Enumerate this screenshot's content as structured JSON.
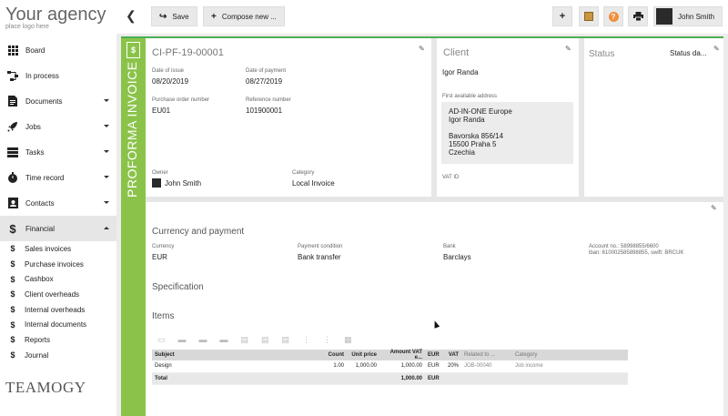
{
  "logo": {
    "title": "Your agency",
    "subtitle": "place logo here"
  },
  "brand": "TEAMOGY",
  "nav": [
    {
      "label": "Board",
      "icon": "grid-icon",
      "caret": false
    },
    {
      "label": "In process",
      "icon": "flow-icon",
      "caret": false
    },
    {
      "label": "Documents",
      "icon": "document-icon",
      "caret": true
    },
    {
      "label": "Jobs",
      "icon": "rocket-icon",
      "caret": true
    },
    {
      "label": "Tasks",
      "icon": "tasks-icon",
      "caret": true
    },
    {
      "label": "Time record",
      "icon": "stopwatch-icon",
      "caret": true
    },
    {
      "label": "Contacts",
      "icon": "contacts-icon",
      "caret": true
    },
    {
      "label": "Financial",
      "icon": "dollar-icon",
      "caret": true
    }
  ],
  "financial_sub": [
    "Sales invoices",
    "Purchase invoices",
    "Cashbox",
    "Client overheads",
    "Internal overheads",
    "Internal documents",
    "Reports",
    "Journal"
  ],
  "toolbar": {
    "save": "Save",
    "compose": "Compose new ...",
    "user": "John Smith"
  },
  "doc": {
    "number": "CI-PF-19-00001",
    "type_label": "PROFORMA INVOICE",
    "date_of_issue_label": "Date of issue",
    "date_of_issue": "08/20/2019",
    "date_of_payment_label": "Date of payment",
    "date_of_payment": "08/27/2019",
    "po_label": "Purchase order number",
    "po": "EU01",
    "ref_label": "Reference number",
    "ref": "101900001",
    "owner_label": "Owner",
    "owner": "John Smith",
    "category_label": "Category",
    "category": "Local Invoice"
  },
  "client": {
    "title": "Client",
    "name": "Igor Randa",
    "address_label": "First available address",
    "address": [
      "AD-IN-ONE Europe",
      "Igor Randa",
      "",
      "Bavorska 856/14",
      "15500 Praha 5",
      "Czechia"
    ],
    "vat_label": "VAT ID"
  },
  "status": {
    "title": "Status",
    "value": "Status da..."
  },
  "payment": {
    "heading": "Currency and payment",
    "currency_label": "Currency",
    "currency": "EUR",
    "condition_label": "Payment condition",
    "condition": "Bank transfer",
    "bank_label": "Bank",
    "bank": "Barclays",
    "account_line1": "Account no.: 58998855/6600",
    "account_line2": "iban: 610002585898855, swift: BRCUK"
  },
  "specification_heading": "Specification",
  "items": {
    "heading": "Items",
    "columns": [
      "Subject",
      "Count",
      "Unit price",
      "Amount VAT e...",
      "EUR",
      "VAT",
      "Related to ...",
      "Category"
    ],
    "rows": [
      [
        "Design",
        "1.00",
        "1,000.00",
        "1,000.00",
        "EUR",
        "20%",
        "JOB-00040",
        "Job income"
      ]
    ],
    "total": [
      "Total",
      "",
      "",
      "1,000.00",
      "EUR",
      "",
      "",
      ""
    ]
  }
}
